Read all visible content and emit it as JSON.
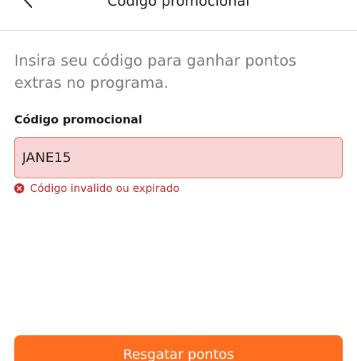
{
  "header": {
    "title": "Código promocional",
    "back_icon": "chevron-left-icon"
  },
  "intro_text": "Insira seu código para ganhar pontos extras no programa.",
  "promo_field": {
    "label": "Código promocional",
    "value": "JANE15",
    "error_icon": "error-circle-x-icon",
    "error_message": "Código invalido ou expirado"
  },
  "submit_button": {
    "label": "Resgatar pontos"
  },
  "colors": {
    "accent": "#ff6d1f",
    "error": "#c4282a",
    "input_error_bg": "#f7d5d7",
    "input_error_border": "#e07a5a",
    "muted_text": "#7a7a7a"
  }
}
